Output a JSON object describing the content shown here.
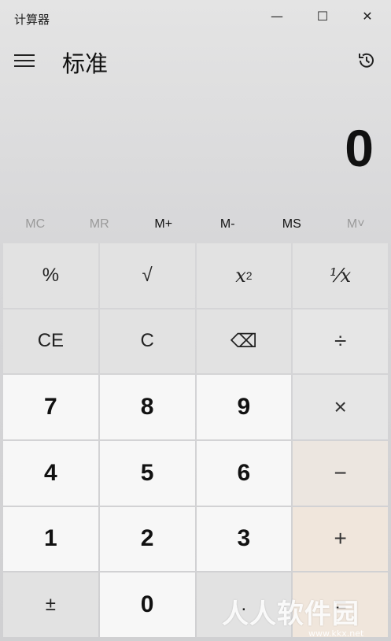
{
  "window": {
    "title": "计算器",
    "minimize_glyph": "—",
    "maximize_glyph": "☐",
    "close_glyph": "✕"
  },
  "header": {
    "mode": "标准"
  },
  "display": {
    "value": "0"
  },
  "memory": [
    {
      "label": "MC",
      "enabled": false
    },
    {
      "label": "MR",
      "enabled": false
    },
    {
      "label": "M+",
      "enabled": true
    },
    {
      "label": "M-",
      "enabled": true
    },
    {
      "label": "MS",
      "enabled": true
    },
    {
      "label": "M˅",
      "enabled": false
    }
  ],
  "keys": {
    "percent": "%",
    "sqrt": "√",
    "square_base": "x",
    "square_exp": "2",
    "reciprocal": "⅟x",
    "ce": "CE",
    "c": "C",
    "backspace": "⌫",
    "divide": "÷",
    "seven": "7",
    "eight": "8",
    "nine": "9",
    "multiply": "×",
    "four": "4",
    "five": "5",
    "six": "6",
    "minus": "−",
    "one": "1",
    "two": "2",
    "three": "3",
    "plus": "+",
    "negate": "±",
    "zero": "0",
    "decimal": ".",
    "equals": "="
  },
  "watermark": {
    "text": "人人软件园",
    "url": "www.kkx.net"
  }
}
